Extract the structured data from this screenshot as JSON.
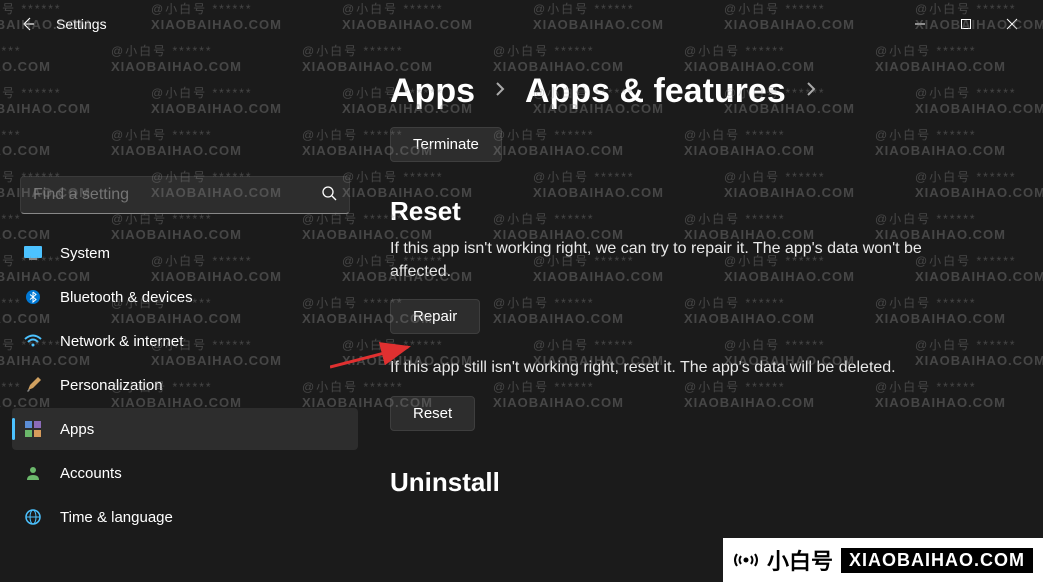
{
  "titlebar": {
    "app_name": "Settings"
  },
  "search": {
    "placeholder": "Find a setting"
  },
  "sidebar": {
    "items": [
      {
        "label": "System"
      },
      {
        "label": "Bluetooth & devices"
      },
      {
        "label": "Network & internet"
      },
      {
        "label": "Personalization"
      },
      {
        "label": "Apps"
      },
      {
        "label": "Accounts"
      },
      {
        "label": "Time & language"
      }
    ]
  },
  "breadcrumb": {
    "level1": "Apps",
    "level2": "Apps & features"
  },
  "content": {
    "terminate_btn": "Terminate",
    "reset_heading": "Reset",
    "repair_desc": "If this app isn't working right, we can try to repair it. The app's data won't be affected.",
    "repair_btn": "Repair",
    "reset_desc": "If this app still isn't working right, reset it. The app's data will be deleted.",
    "reset_btn": "Reset",
    "uninstall_heading": "Uninstall"
  },
  "watermark": {
    "line1": "@小白号",
    "line2": "XIAOBAIHAO.COM",
    "logo_cn": "小白号",
    "logo_en": "XIAOBAIHAO.COM"
  }
}
